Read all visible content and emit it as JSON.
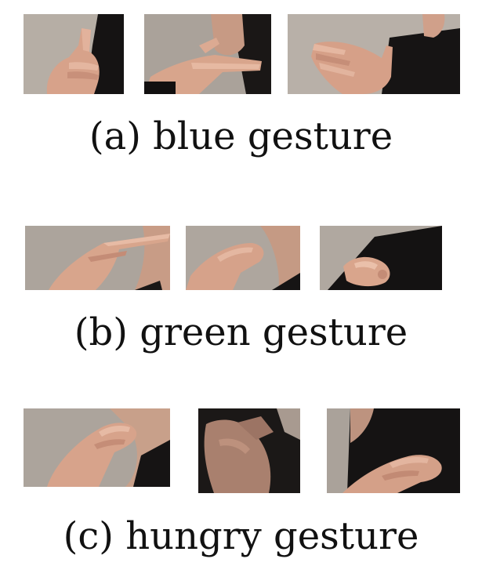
{
  "panels": [
    {
      "caption": "(a) blue gesture",
      "frames": [
        {
          "description": "hand with fingers raised in front of dark shirt"
        },
        {
          "description": "hand held flat near mouth"
        },
        {
          "description": "open hand with spread fingers in front of chest"
        }
      ]
    },
    {
      "caption": "(b) green gesture",
      "frames": [
        {
          "description": "pointing finger held horizontally near chin"
        },
        {
          "description": "curled hand near chin"
        },
        {
          "description": "hand pinched low in front of dark shirt"
        }
      ]
    },
    {
      "caption": "(c) hungry gesture",
      "frames": [
        {
          "description": "curled hand raised to mouth"
        },
        {
          "description": "hand moving down over chest"
        },
        {
          "description": "hand resting on stomach"
        }
      ]
    }
  ],
  "colors": {
    "wall": "#b4aca4",
    "shirt": "#141212",
    "skin": "#d9a48c",
    "skin_shadow": "#a9725e",
    "caption_text": "#111111"
  }
}
